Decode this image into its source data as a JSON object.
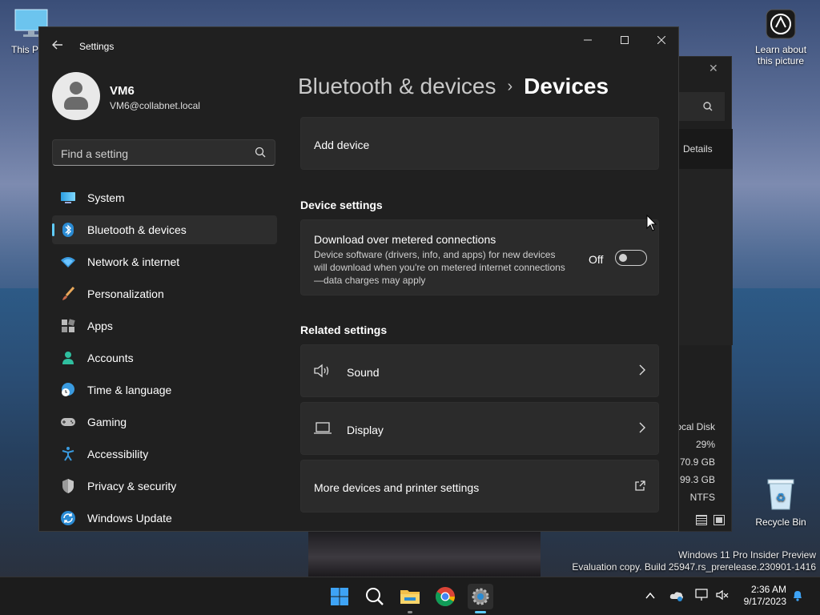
{
  "desktop": {
    "this_pc_label": "This PC",
    "learn_label_line1": "Learn about",
    "learn_label_line2": "this picture",
    "recycle_bin_label": "Recycle Bin",
    "watermark_line1": "Windows 11 Pro Insider Preview",
    "watermark_line2": "Evaluation copy. Build 25947.rs_prerelease.230901-1416"
  },
  "explorer_bg": {
    "details_label": "Details",
    "rows": [
      "ocal Disk",
      "29%",
      "70.9 GB",
      "99.3 GB",
      "NTFS"
    ]
  },
  "window": {
    "title": "Settings"
  },
  "profile": {
    "name": "VM6",
    "email": "VM6@collabnet.local"
  },
  "search": {
    "placeholder": "Find a setting"
  },
  "nav": {
    "items": [
      {
        "label": "System",
        "icon": "monitor-icon"
      },
      {
        "label": "Bluetooth & devices",
        "icon": "bluetooth-icon",
        "active": true
      },
      {
        "label": "Network & internet",
        "icon": "wifi-icon"
      },
      {
        "label": "Personalization",
        "icon": "brush-icon"
      },
      {
        "label": "Apps",
        "icon": "apps-icon"
      },
      {
        "label": "Accounts",
        "icon": "person-icon"
      },
      {
        "label": "Time & language",
        "icon": "globe-clock-icon"
      },
      {
        "label": "Gaming",
        "icon": "gamepad-icon"
      },
      {
        "label": "Accessibility",
        "icon": "accessibility-icon"
      },
      {
        "label": "Privacy & security",
        "icon": "shield-icon"
      },
      {
        "label": "Windows Update",
        "icon": "update-icon"
      }
    ]
  },
  "breadcrumb": {
    "parent": "Bluetooth & devices",
    "separator": "›",
    "current": "Devices"
  },
  "content": {
    "add_device": "Add device",
    "device_settings_header": "Device settings",
    "metered": {
      "title": "Download over metered connections",
      "description": "Device software (drivers, info, and apps) for new devices will download when you're on metered internet connections—data charges may apply",
      "state_label": "Off",
      "enabled": false
    },
    "related_header": "Related settings",
    "sound": "Sound",
    "display": "Display",
    "more_devices": "More devices and printer settings"
  },
  "taskbar": {
    "time": "2:36 AM",
    "date": "9/17/2023"
  },
  "colors": {
    "accent": "#60cdff",
    "window_bg": "#202020",
    "card_bg": "#2b2b2b"
  }
}
